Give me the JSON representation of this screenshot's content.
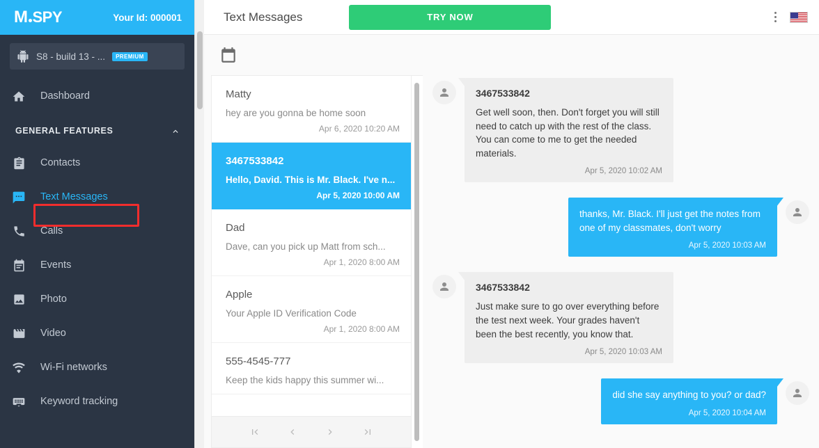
{
  "brand": {
    "logo_m": "M",
    "logo_spy": "SPY",
    "user_id": "Your Id: 000001"
  },
  "device": {
    "name": "S8 - build 13 - ...",
    "badge": "PREMIUM",
    "icon": "android-icon"
  },
  "sidebar": {
    "dashboard": {
      "label": "Dashboard",
      "icon": "home-icon"
    },
    "section_label": "GENERAL FEATURES",
    "items": [
      {
        "label": "Contacts",
        "icon": "contacts-icon",
        "active": false
      },
      {
        "label": "Text Messages",
        "icon": "message-icon",
        "active": true
      },
      {
        "label": "Calls",
        "icon": "phone-icon",
        "active": false
      },
      {
        "label": "Events",
        "icon": "calendar-icon",
        "active": false
      },
      {
        "label": "Photo",
        "icon": "image-icon",
        "active": false
      },
      {
        "label": "Video",
        "icon": "video-icon",
        "active": false
      },
      {
        "label": "Wi-Fi networks",
        "icon": "wifi-icon",
        "active": false
      },
      {
        "label": "Keyword tracking",
        "icon": "keyboard-icon",
        "active": false
      }
    ]
  },
  "topbar": {
    "title": "Text Messages",
    "try_now": "TRY NOW",
    "kebab_icon": "more-vertical-icon",
    "flag_icon": "us-flag-icon"
  },
  "toolbar": {
    "calendar_icon": "calendar-icon"
  },
  "conversations": [
    {
      "name": "Matty",
      "snippet": "hey are you gonna be home soon",
      "time": "Apr 6, 2020 10:20 AM",
      "selected": false
    },
    {
      "name": "3467533842",
      "snippet": "Hello, David. This is Mr. Black. I've n...",
      "time": "Apr 5, 2020 10:00 AM",
      "selected": true
    },
    {
      "name": "Dad",
      "snippet": "Dave, can you pick up Matt from sch...",
      "time": "Apr 1, 2020 8:00 AM",
      "selected": false
    },
    {
      "name": "Apple",
      "snippet": "Your Apple ID Verification Code",
      "time": "Apr 1, 2020 8:00 AM",
      "selected": false
    },
    {
      "name": "555-4545-777",
      "snippet": "Keep the kids happy this summer wi...",
      "time": "",
      "selected": false
    }
  ],
  "pager": {
    "first": "first-page-icon",
    "prev": "previous-page-icon",
    "next": "next-page-icon",
    "last": "last-page-icon"
  },
  "messages": [
    {
      "direction": "in",
      "sender": "3467533842",
      "body": "Get well soon, then. Don't forget you will still need to catch up with the rest of the class. You can come to me to get the needed materials.",
      "time": "Apr 5, 2020 10:02 AM"
    },
    {
      "direction": "out",
      "sender": "",
      "body": "thanks, Mr. Black. I'll just get the notes from one of my classmates, don't worry",
      "time": "Apr 5, 2020 10:03 AM"
    },
    {
      "direction": "in",
      "sender": "3467533842",
      "body": "Just make sure to go over everything before the test next week. Your grades haven't been the best recently, you know that.",
      "time": "Apr 5, 2020 10:03 AM"
    },
    {
      "direction": "out",
      "sender": "",
      "body": "did she say anything to you? or dad?",
      "time": "Apr 5, 2020 10:04 AM"
    }
  ],
  "colors": {
    "brand_blue": "#29b6f6",
    "sidebar_dark": "#2b3544",
    "accent_green": "#2ecc77",
    "highlight_red": "#f22d2d"
  }
}
